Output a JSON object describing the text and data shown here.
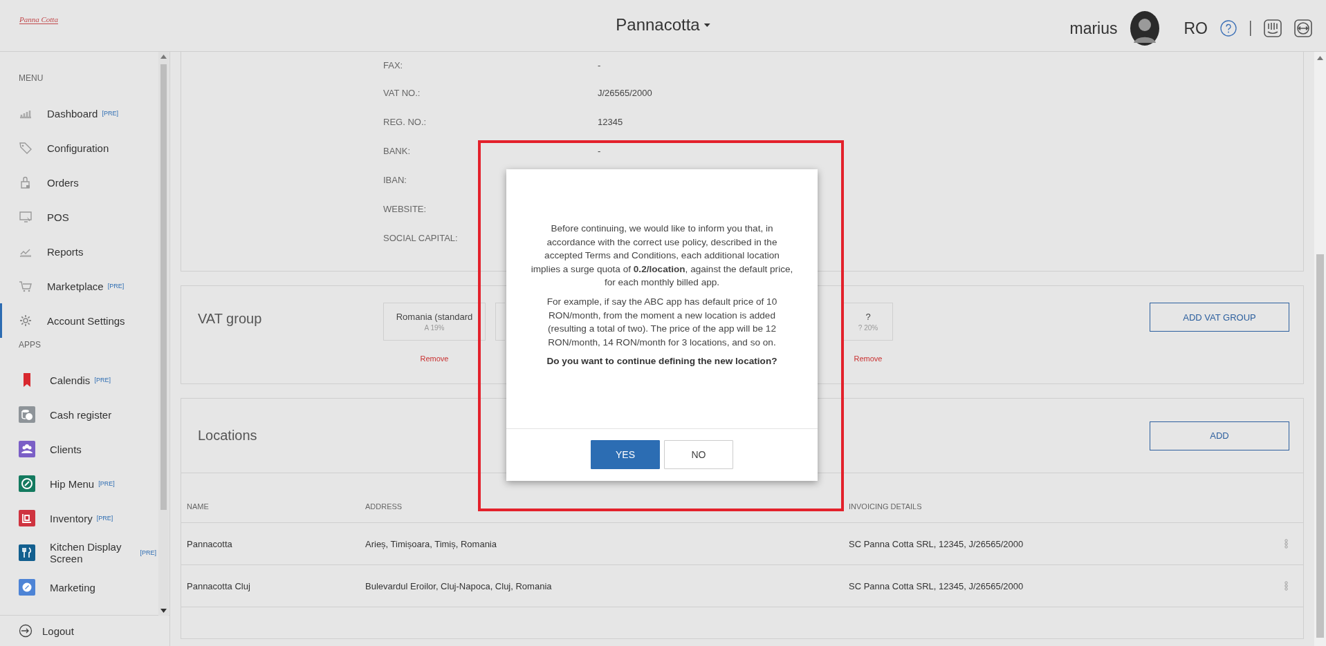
{
  "header": {
    "logo": "Panna Cotta",
    "title": "Pannacotta",
    "user": "marius",
    "language": "RO"
  },
  "sidebar": {
    "sections": [
      {
        "heading": "MENU",
        "items": [
          {
            "label": "Dashboard",
            "badge": "[PRE]",
            "selected": false
          },
          {
            "label": "Configuration",
            "selected": false
          },
          {
            "label": "Orders",
            "selected": false
          },
          {
            "label": "POS",
            "selected": false
          },
          {
            "label": "Reports",
            "selected": false
          },
          {
            "label": "Marketplace",
            "badge": "[PRE]",
            "selected": false
          },
          {
            "label": "Account Settings",
            "selected": true
          }
        ]
      },
      {
        "heading": "APPS",
        "items": [
          {
            "label": "Calendis",
            "badge": "[PRE]",
            "selected": false,
            "color": "#d8282e"
          },
          {
            "label": "Cash register",
            "selected": false,
            "color": "#8e9499"
          },
          {
            "label": "Clients",
            "selected": false,
            "color": "#7b5fc6"
          },
          {
            "label": "Hip Menu",
            "badge": "[PRE]",
            "selected": false,
            "color": "#137a5f"
          },
          {
            "label": "Inventory",
            "badge": "[PRE]",
            "selected": false,
            "color": "#cf3440"
          },
          {
            "label": "Kitchen Display Screen",
            "badge": "[PRE]",
            "selected": false,
            "color": "#125f8f"
          },
          {
            "label": "Marketing",
            "selected": false,
            "color": "#4d84d6"
          }
        ]
      }
    ],
    "logout": "Logout"
  },
  "details": [
    {
      "label": "FAX:",
      "value": "-"
    },
    {
      "label": "VAT NO.:",
      "value": "J/26565/2000"
    },
    {
      "label": "REG. NO.:",
      "value": "12345"
    },
    {
      "label": "BANK:",
      "value": "-"
    },
    {
      "label": "IBAN:"
    },
    {
      "label": "WEBSITE:"
    },
    {
      "label": "SOCIAL CAPITAL:"
    }
  ],
  "vat_group": {
    "title": "VAT group",
    "groups": [
      {
        "name": "Romania (standard",
        "rate": "A 19%",
        "remove": "Remove"
      },
      {
        "kind": "covered"
      },
      {
        "name": "?",
        "rate": "? 20%",
        "remove": "Remove"
      }
    ],
    "add_button": "ADD VAT GROUP"
  },
  "locations": {
    "title": "Locations",
    "add_button": "ADD",
    "columns": [
      "NAME",
      "ADDRESS",
      "INVOICING DETAILS"
    ],
    "rows": [
      [
        "Pannacotta",
        "Arieș, Timișoara, Timiș, Romania",
        "SC Panna Cotta SRL, 12345, J/26565/2000"
      ],
      [
        "Pannacotta Cluj",
        "Bulevardul Eroilor, Cluj-Napoca, Cluj, Romania",
        "SC Panna Cotta SRL, 12345, J/26565/2000"
      ]
    ]
  },
  "modal": {
    "paragraphs": [
      "Before continuing, we would like to inform you that, in accordance with the correct use policy, described in the accepted Terms and Conditions, each additional location implies a surge quota of **0.2/location**, against the default price, for each monthly billed app.",
      "For example, if say the ABC app has default price of 10 RON/month, from the moment a new location is added (resulting a total of two). The price of the app will be 12 RON/month, 14 RON/month for 3 locations, and so on."
    ],
    "question": "Do you want to continue defining the new location?",
    "buttons": [
      {
        "label": "YES",
        "primary": true
      },
      {
        "label": "NO",
        "primary": false
      }
    ]
  },
  "highlight_frame": true
}
